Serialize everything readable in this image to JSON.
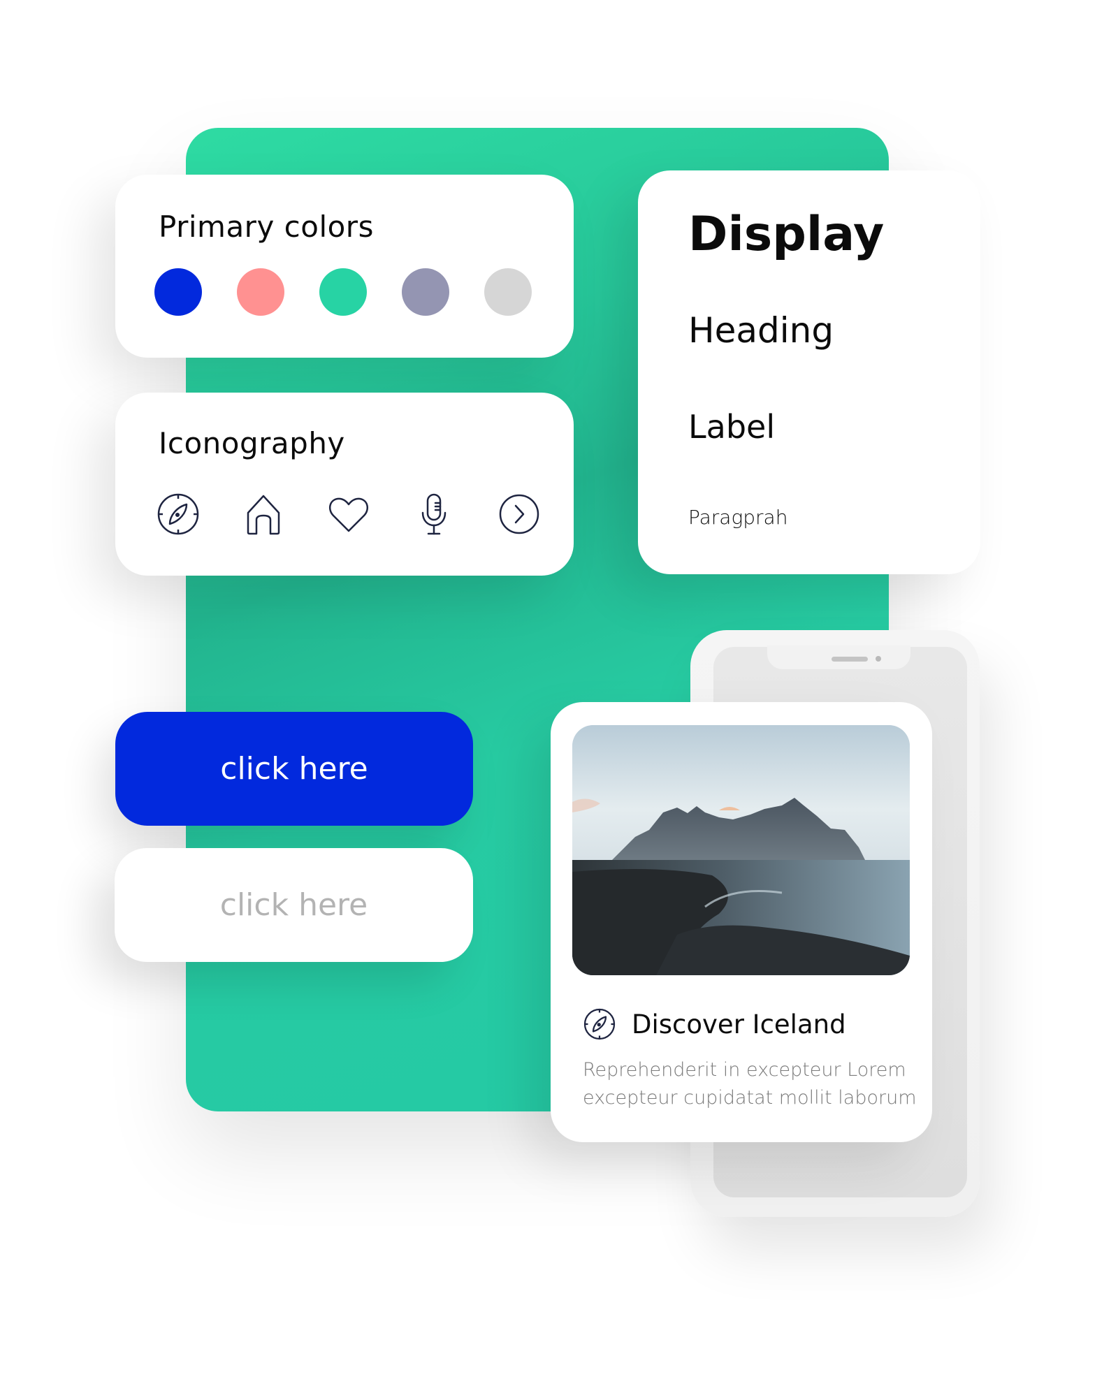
{
  "colors_card": {
    "title": "Primary colors",
    "swatches": [
      {
        "name": "blue",
        "hex": "#0229dd"
      },
      {
        "name": "salmon",
        "hex": "#ff9191"
      },
      {
        "name": "green",
        "hex": "#27d3a4"
      },
      {
        "name": "lavender",
        "hex": "#9495b2"
      },
      {
        "name": "light-gray",
        "hex": "#d6d6d6"
      }
    ]
  },
  "icons_card": {
    "title": "Iconography",
    "icons": [
      "compass-icon",
      "home-icon",
      "heart-icon",
      "microphone-icon",
      "chevron-right-circle-icon"
    ],
    "icon_color": "#1e2440"
  },
  "typography_card": {
    "display": "Display",
    "heading": "Heading",
    "label": "Label",
    "paragraph": "Paragprah"
  },
  "buttons": {
    "primary_label": "click here",
    "secondary_label": "click here",
    "primary_color": "#0229dd"
  },
  "accent_color": "#27d3a4",
  "iceland_card": {
    "image_alt": "Mountains beside black sand beach",
    "title": "Discover Iceland",
    "description": "Reprehenderit in excepteur Lorem excepteur cupidatat mollit laborum"
  }
}
